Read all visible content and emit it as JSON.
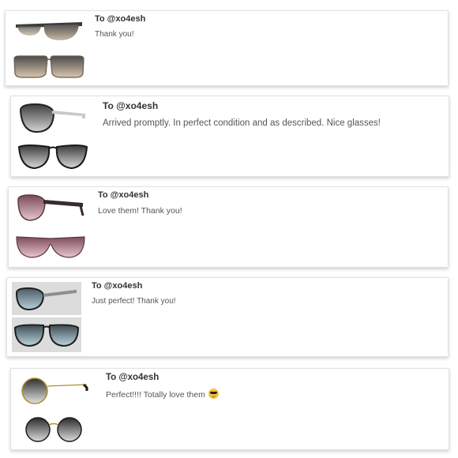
{
  "reviews": [
    {
      "recipient": "To @xo4esh",
      "message": "Thank you!",
      "emoji": false
    },
    {
      "recipient": "To @xo4esh",
      "message": "Arrived promptly. In perfect condition and as described. Nice glasses!",
      "emoji": false
    },
    {
      "recipient": "To @xo4esh",
      "message": "Love them! Thank you!",
      "emoji": false
    },
    {
      "recipient": "To @xo4esh",
      "message": "Just perfect! Thank you!",
      "emoji": false
    },
    {
      "recipient": "To @xo4esh",
      "message": "Perfect!!!! Totally love them",
      "emoji": true
    }
  ],
  "colors": {
    "card_border": "#e2e2e2",
    "text_dark": "#333333",
    "text_body": "#555555",
    "lens_grey": "#6f6f6f",
    "lens_rose": "#b07a86",
    "lens_blue": "#8fa9b6"
  },
  "icons": {
    "sunglasses_emoji": "smiling-face-with-sunglasses"
  }
}
